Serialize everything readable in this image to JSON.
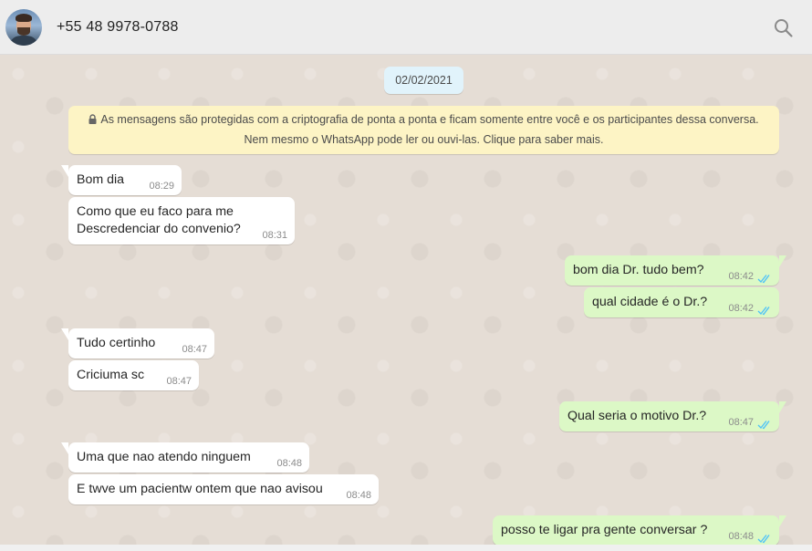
{
  "header": {
    "contact_name": "+55 48 9978-0788",
    "avatar_icon": "contact-avatar",
    "search_icon": "search-icon"
  },
  "chat": {
    "date": "02/02/2021",
    "encryption_notice": {
      "line1": "As mensagens são protegidas com a criptografia de ponta a ponta e ficam somente entre você e os participantes dessa conversa.",
      "line2": "Nem mesmo o WhatsApp pode ler ou ouvi-las. Clique para saber mais."
    },
    "messages": [
      {
        "direction": "in",
        "text": "Bom dia",
        "time": "08:29"
      },
      {
        "direction": "in",
        "text_line1": "Como que eu faco para me",
        "text_line2": "Descredenciar do convenio?",
        "time": "08:31"
      },
      {
        "direction": "out",
        "text": "bom dia Dr. tudo bem?",
        "time": "08:42",
        "status": "read"
      },
      {
        "direction": "out",
        "text": "qual cidade é o Dr.?",
        "time": "08:42",
        "status": "read"
      },
      {
        "direction": "in",
        "text": "Tudo certinho",
        "time": "08:47"
      },
      {
        "direction": "in",
        "text": "Criciuma sc",
        "time": "08:47"
      },
      {
        "direction": "out",
        "text": "Qual seria o motivo Dr.?",
        "time": "08:47",
        "status": "read"
      },
      {
        "direction": "in",
        "text": "Uma que nao atendo ninguem",
        "time": "08:48"
      },
      {
        "direction": "in",
        "text": "E twve um pacientw ontem que nao avisou",
        "time": "08:48"
      },
      {
        "direction": "out",
        "text": "posso te ligar pra gente conversar ?",
        "time": "08:48",
        "status": "read"
      }
    ]
  },
  "colors": {
    "incoming_bubble": "#ffffff",
    "outgoing_bubble": "#dcf8c6",
    "read_ticks": "#4fc3f7",
    "chat_background": "#e5ddd5",
    "encryption_banner": "#fdf4c5",
    "date_pill": "#e1f3fb"
  }
}
